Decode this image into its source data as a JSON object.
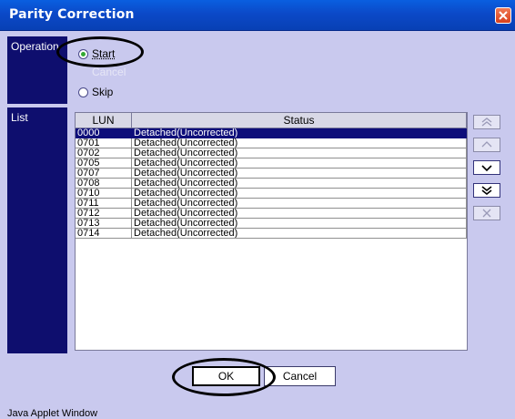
{
  "window": {
    "title": "Parity Correction"
  },
  "operation": {
    "label": "Operation",
    "options": [
      {
        "label": "Start",
        "selected": true,
        "enabled": true
      },
      {
        "label": "Cancel",
        "selected": false,
        "enabled": false
      },
      {
        "label": "Skip",
        "selected": false,
        "enabled": true
      }
    ]
  },
  "list": {
    "label": "List",
    "columns": [
      "LUN",
      "Status"
    ],
    "rows": [
      {
        "lun": "0000",
        "status": "Detached(Uncorrected)",
        "selected": true
      },
      {
        "lun": "0701",
        "status": "Detached(Uncorrected)"
      },
      {
        "lun": "0702",
        "status": "Detached(Uncorrected)"
      },
      {
        "lun": "0705",
        "status": "Detached(Uncorrected)"
      },
      {
        "lun": "0707",
        "status": "Detached(Uncorrected)"
      },
      {
        "lun": "0708",
        "status": "Detached(Uncorrected)"
      },
      {
        "lun": "0710",
        "status": "Detached(Uncorrected)"
      },
      {
        "lun": "0711",
        "status": "Detached(Uncorrected)"
      },
      {
        "lun": "0712",
        "status": "Detached(Uncorrected)"
      },
      {
        "lun": "0713",
        "status": "Detached(Uncorrected)"
      },
      {
        "lun": "0714",
        "status": "Detached(Uncorrected)"
      }
    ],
    "side_buttons": [
      "move-to-top-icon",
      "move-up-icon",
      "move-down-icon",
      "move-to-bottom-icon",
      "remove-icon"
    ]
  },
  "buttons": {
    "ok": "OK",
    "cancel": "Cancel"
  },
  "footer": {
    "java_text": "Java Applet Window"
  },
  "colors": {
    "title_bar": "#0b49c8",
    "panel_bg": "#c9c9ee",
    "label_bg": "#0e0e6e",
    "selection": "#0e0e7a"
  }
}
